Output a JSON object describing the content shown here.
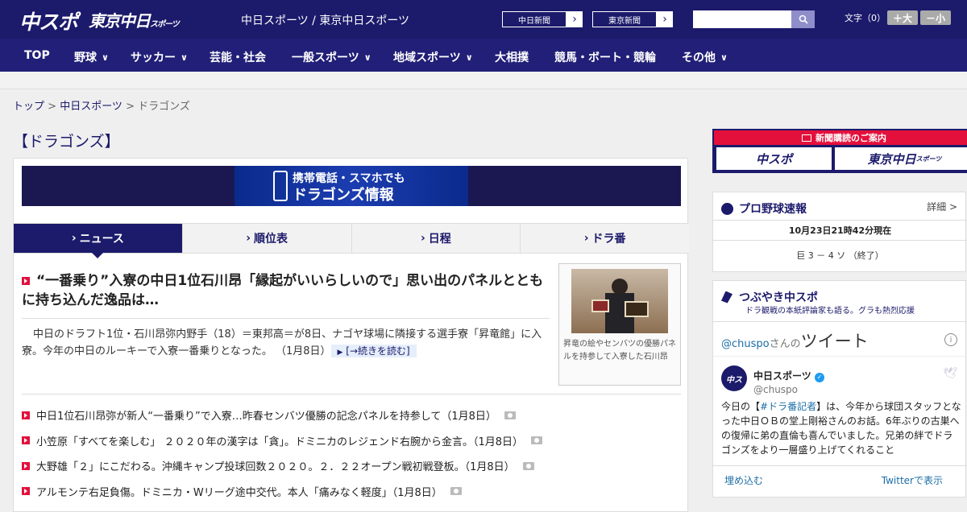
{
  "header": {
    "logo_chunichi_sports": "中スポ",
    "logo_tokyo_chunichi": "東京中日",
    "logo_tokyo_small": "スポーツ",
    "site_name": "中日スポーツ / 東京中日スポーツ",
    "ext_links": [
      "中日新聞",
      "東京新聞"
    ],
    "search_placeholder": "",
    "font_size_label": "文字（0）",
    "font_bigger": "＋大",
    "font_smaller": "－小"
  },
  "nav": [
    {
      "label": "TOP",
      "chev": false
    },
    {
      "label": "野球",
      "chev": true
    },
    {
      "label": "サッカー",
      "chev": true
    },
    {
      "label": "芸能・社会",
      "chev": false
    },
    {
      "label": "一般スポーツ",
      "chev": true
    },
    {
      "label": "地域スポーツ",
      "chev": true
    },
    {
      "label": "大相撲",
      "chev": false
    },
    {
      "label": "競馬・ボート・競輪",
      "chev": false
    },
    {
      "label": "その他",
      "chev": true
    }
  ],
  "breadcrumb": {
    "top": "トップ",
    "sep": " > ",
    "section": "中日スポーツ",
    "current": "ドラゴンズ"
  },
  "page_title": "【ドラゴンズ】",
  "banner": {
    "line1": "携帯電話・スマホでも",
    "line2": "ドラゴンズ情報"
  },
  "tabs": [
    "ニュース",
    "順位表",
    "日程",
    "ドラ番"
  ],
  "lead": {
    "title": "“一番乗り”入寮の中日1位石川昂「縁起がいいらしいので」思い出のパネルとともに持ち込んだ逸品は…",
    "body": "中日のドラフト1位・石川昂弥内野手（18）＝東邦高＝が8日、ナゴヤ球場に隣接する選手寮「昇竜館」に入寮。今年の中日のルーキーで入寮一番乗りとなった。 （1月8日）",
    "more": "[→続きを読む]",
    "photo_caption": "昇竜の絵やセンバツの優勝パネルを持参して入寮した石川昂"
  },
  "news": [
    "中日1位石川昂弥が新人“一番乗り”で入寮…昨春センバツ優勝の記念パネルを持参して（1月8日）",
    "小笠原「すべてを楽しむ」 ２０２０年の漢字は「貪」。ドミニカのレジェンド右腕から金言。（1月8日）",
    "大野雄「２」にこだわる。沖縄キャンプ投球回数２０２０。２．２２オープン戦初戦登板。（1月8日）",
    "アルモンテ右足負傷。ドミニカ・Wリーグ途中交代。本人「痛みなく軽度」（1月8日）"
  ],
  "side": {
    "subscribe_header": "新聞購読のご案内",
    "subscribe_logos": [
      "中スポ",
      "東京中日"
    ],
    "subscribe_logo_small": "スポーツ",
    "pro_title": "プロ野球速報",
    "pro_detail": "詳細 >",
    "pro_time": "10月23日21時42分現在",
    "pro_score": "巨 3 － 4 ソ （終了）",
    "tweet_title": "つぶやき中スポ",
    "tweet_sub": "ドラ観戦の本紙評論家も語る。グラも熱烈応援",
    "tweet_handle_prefix": "@chuspo",
    "tweet_handle_suffix": "さんの",
    "tweet_head": "ツイート",
    "tweet_name": "中日スポーツ",
    "tweet_account": "@chuspo",
    "tweet_text_1": "今日の【",
    "tweet_hashtag": "#ドラ番記者",
    "tweet_text_2": "】は、今年から球団スタッフとなった中日ＯＢの堂上剛裕さんのお話。6年ぶりの古巣への復帰に弟の直倫も喜んでいました。兄弟の絆でドラゴンズをより一層盛り上げてくれること",
    "tweet_embed": "埋め込む",
    "tweet_view": "Twitterで表示"
  },
  "colors": {
    "navy": "#1c1a6b",
    "red": "#e4103c"
  }
}
